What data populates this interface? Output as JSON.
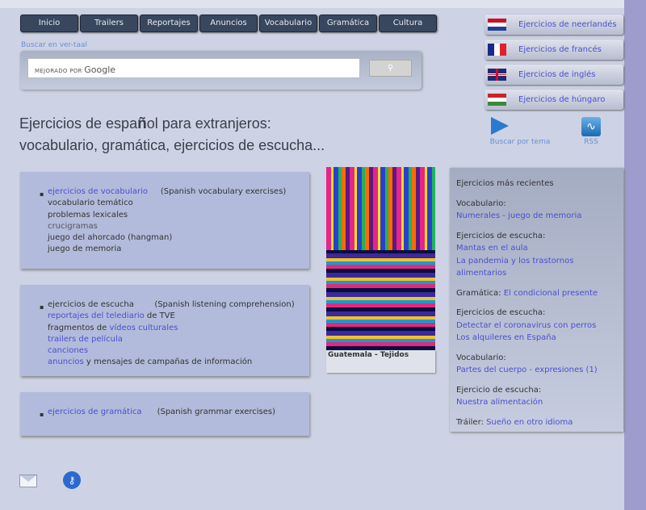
{
  "nav": [
    "Inicio",
    "Trailers",
    "Reportajes",
    "Anuncios",
    "Vocabulario",
    "Gramática",
    "Cultura"
  ],
  "search": {
    "label": "Buscar en ver-taal",
    "placeholder_small": "MEJORADO POR",
    "placeholder_brand": "Google",
    "button_icon": "search-icon"
  },
  "title": {
    "p1": "Ejercicios de espa",
    "p2": "ñ",
    "p3": "ol para extranjeros:",
    "line2": "vocabulario, gramática, ejercicios de escucha..."
  },
  "languages": [
    {
      "label": "Ejercicios de neerlandés",
      "flag": "nl"
    },
    {
      "label": "Ejercicios de francés",
      "flag": "fr"
    },
    {
      "label": "Ejercicios de inglés",
      "flag": "gb"
    },
    {
      "label": "Ejercicios de húngaro",
      "flag": "hu"
    }
  ],
  "topic": {
    "label": "Buscar por tema",
    "icon": "arrow-right-icon"
  },
  "rss": {
    "label": "RSS",
    "icon": "rss-icon"
  },
  "vocab_box": {
    "link": "ejercicios de vocabulario",
    "note": "(Spanish vocabulary exercises)",
    "items": [
      "vocabulario temático",
      "problemas lexicales",
      "crucigramas",
      "juego del ahorcado (hangman)",
      "juego de memoria"
    ]
  },
  "listen_box": {
    "head": "ejercicios de escucha",
    "note": "(Spanish listening comprehension)",
    "l1a": "reportajes del telediario",
    "l1b": " de TVE",
    "l2a": "fragmentos de ",
    "l2b": "vídeos culturales",
    "l3": "trailers de película",
    "l4": "canciones",
    "l5a": "anuncios",
    "l5b": " y mensajes de campañas de información"
  },
  "grammar_box": {
    "link": "ejercicios de gramática",
    "note": "(Spanish grammar exercises)"
  },
  "image_caption": "Guatemala - Tejidos",
  "recent": {
    "title": "Ejercicios más recientes",
    "groups": [
      {
        "label": "Vocabulario:",
        "links": [
          "Numerales - juego de memoria"
        ]
      },
      {
        "label": "Ejercicios de escucha:",
        "links": [
          "Mantas en el aula",
          "La pandemia y los trastornos alimentarios"
        ]
      },
      {
        "label": "Gramática: ",
        "links": [
          "El condicional presente"
        ],
        "inline": true
      },
      {
        "label": "Ejercicios de escucha:",
        "links": [
          "Detectar el coronavirus con perros",
          "Los alquileres en España"
        ]
      },
      {
        "label": "Vocabulario:",
        "links": [
          "Partes del cuerpo - expresiones (1)"
        ]
      },
      {
        "label": "Ejercicio de escucha:",
        "links": [
          "Nuestra alimentación"
        ]
      },
      {
        "label": "Tráiler: ",
        "links": [
          "Sueño en otro idioma"
        ],
        "inline": true
      }
    ]
  },
  "footer_icons": [
    "envelope-icon",
    "key-icon"
  ],
  "colors": {
    "link": "#4a4fd0",
    "nav_bg": "#38465e",
    "page_bg": "#cdd3e5"
  }
}
